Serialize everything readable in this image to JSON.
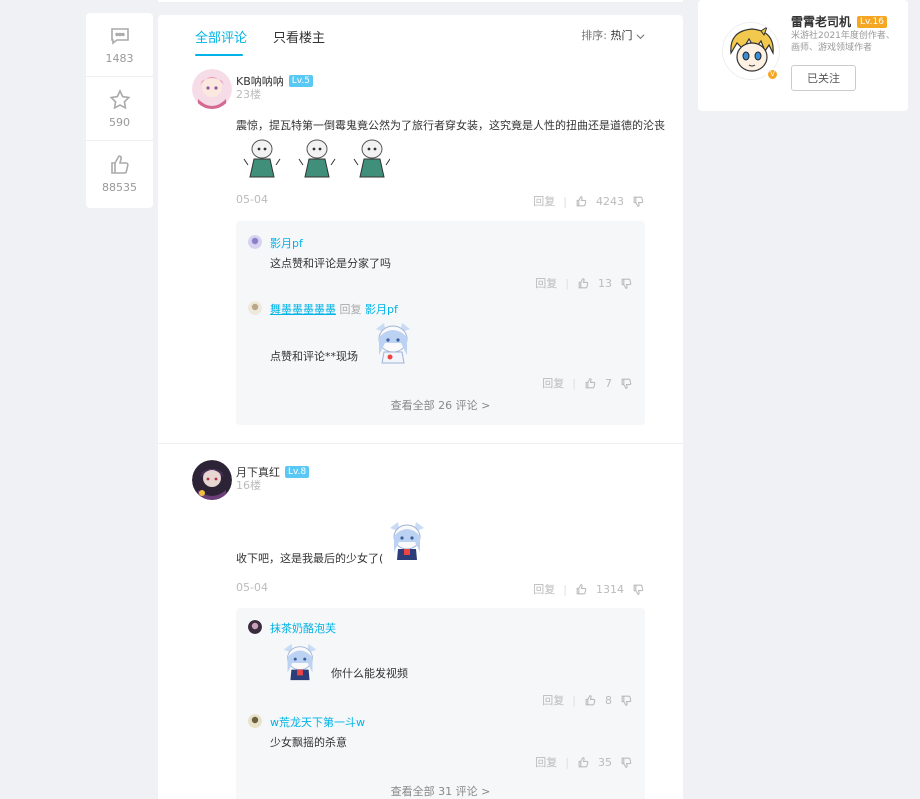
{
  "rail": {
    "comment_count": "1483",
    "star_count": "590",
    "like_count": "88535"
  },
  "tabs": {
    "all_comments": "全部评论",
    "author_only": "只看楼主",
    "sort_label": "排序:",
    "sort_value": "热门"
  },
  "comments": [
    {
      "user": "KB呐呐呐",
      "level": "Lv.5",
      "floor": "23楼",
      "text": "震惊，提瓦特第一倒霉鬼竟公然为了旅行者穿女装，这究竟是人性的扭曲还是道德的沦丧",
      "date": "05-04",
      "reply_label": "回复",
      "likes": "4243",
      "replies": [
        {
          "user": "影月pf",
          "text": "这点赞和评论是分家了吗",
          "reply_label": "回复",
          "likes": "13"
        },
        {
          "user": "舞墨墨墨墨墨",
          "reply_word": "回复",
          "reply_to": "影月pf",
          "text": "点赞和评论**现场",
          "reply_label": "回复",
          "likes": "7"
        }
      ],
      "view_all": "查看全部 26 评论 >"
    },
    {
      "user": "月下真红",
      "level": "Lv.8",
      "floor": "16楼",
      "text": "收下吧，这是我最后的少女了(",
      "date": "05-04",
      "reply_label": "回复",
      "likes": "1314",
      "replies": [
        {
          "user": "抹茶奶酪泡芙",
          "text": "你什么能发视频",
          "reply_label": "回复",
          "likes": "8"
        },
        {
          "user": "w荒龙天下第一斗w",
          "text": "少女飘摇的杀意",
          "reply_label": "回复",
          "likes": "35"
        }
      ],
      "view_all": "查看全部 31 评论 >"
    }
  ],
  "author": {
    "name": "雷霄老司机",
    "level": "Lv.16",
    "desc": "米游社2021年度创作者、画师、游戏领域作者",
    "verify_mark": "V",
    "follow_label": "已关注"
  },
  "colors": {
    "accent": "#00b3e6",
    "level_blue": "#5ac8f5",
    "level_gold": "#f5a623"
  }
}
